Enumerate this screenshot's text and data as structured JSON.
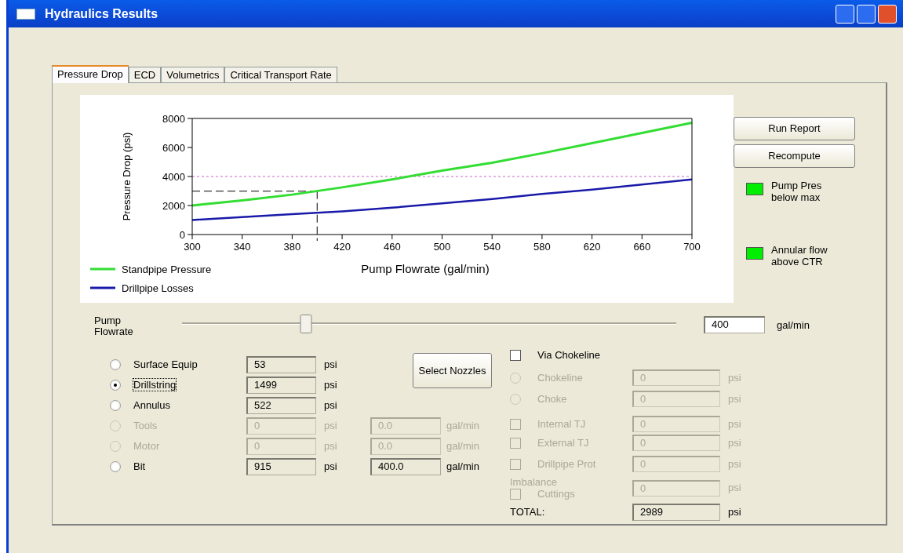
{
  "window": {
    "title": "Hydraulics Results"
  },
  "tabs": [
    {
      "label": "Pressure Drop",
      "selected": true
    },
    {
      "label": "ECD",
      "selected": false
    },
    {
      "label": "Volumetrics",
      "selected": false
    },
    {
      "label": "Critical Transport Rate",
      "selected": false
    }
  ],
  "chart": {
    "chart_data": {
      "type": "line",
      "xlabel": "Pump Flowrate (gal/min)",
      "ylabel": "Pressure Drop (psi)",
      "x": [
        300,
        340,
        380,
        420,
        460,
        500,
        540,
        580,
        620,
        660,
        700
      ],
      "series": [
        {
          "name": "Standpipe Pressure",
          "color": "#33dd33",
          "values": [
            2000,
            2350,
            2750,
            3250,
            3800,
            4400,
            4950,
            5600,
            6300,
            7000,
            7700
          ]
        },
        {
          "name": "Drillpipe Losses",
          "color": "#1a1aaa",
          "values": [
            1000,
            1200,
            1400,
            1600,
            1850,
            2150,
            2450,
            2800,
            3100,
            3450,
            3800
          ]
        }
      ],
      "xlim": [
        300,
        700
      ],
      "ylim": [
        0,
        8000
      ],
      "xticks": [
        300,
        340,
        380,
        420,
        460,
        500,
        540,
        580,
        620,
        660,
        700
      ],
      "yticks": [
        0,
        2000,
        4000,
        6000,
        8000
      ],
      "legend": true,
      "ref_lines": [
        {
          "axis": "y",
          "value": 4000,
          "color": "#cc66cc"
        },
        {
          "axis": "y",
          "value": 2989,
          "color": "#000000"
        },
        {
          "axis": "x",
          "value": 400,
          "color": "#000000"
        }
      ]
    }
  },
  "buttons": [
    {
      "label": "Run Report"
    },
    {
      "label": "Recompute"
    }
  ],
  "indicators": [
    {
      "label": "Pump Pres below max",
      "color": "#00ee00"
    },
    {
      "label": "Annular flow above CTR",
      "color": "#00ee00"
    }
  ],
  "flowrate": {
    "label": "Pump Flowrate",
    "level": 0.25,
    "value": "400",
    "unit": "gal/min"
  },
  "components": [
    {
      "label": "Surface Equip",
      "selected": false,
      "focused": false,
      "disabled": false,
      "pressure": "53",
      "unit": "psi"
    },
    {
      "label": "Drillstring",
      "selected": true,
      "focused": true,
      "disabled": false,
      "pressure": "1499",
      "unit": "psi"
    },
    {
      "label": "Annulus",
      "selected": false,
      "focused": false,
      "disabled": false,
      "pressure": "522",
      "unit": "psi"
    },
    {
      "label": "Tools",
      "selected": false,
      "focused": false,
      "disabled": true,
      "pressure": "0",
      "unit": "psi",
      "flow": "0.0",
      "flow_unit": "gal/min"
    },
    {
      "label": "Motor",
      "selected": false,
      "focused": false,
      "disabled": true,
      "pressure": "0",
      "unit": "psi",
      "flow": "0.0",
      "flow_unit": "gal/min"
    },
    {
      "label": "Bit",
      "selected": false,
      "focused": false,
      "disabled": false,
      "pressure": "915",
      "unit": "psi",
      "flow": "400.0",
      "flow_unit": "gal/min"
    }
  ],
  "select_nozzles": {
    "label": "Select Nozzles"
  },
  "chokeline": {
    "label": "Via Chokeline",
    "checked": false
  },
  "extras": [
    {
      "kind": "radio",
      "label": "Chokeline",
      "selected": false,
      "disabled": true,
      "value": "0",
      "unit": "psi"
    },
    {
      "kind": "radio",
      "label": "Choke",
      "selected": false,
      "disabled": true,
      "value": "0",
      "unit": "psi"
    },
    {
      "kind": "checkbox",
      "label": "Internal TJ",
      "checked": false,
      "disabled": true,
      "value": "0",
      "unit": "psi"
    },
    {
      "kind": "checkbox",
      "label": "External TJ",
      "checked": false,
      "disabled": true,
      "value": "0",
      "unit": "psi"
    },
    {
      "kind": "checkbox",
      "label": "Drillpipe Prot",
      "checked": false,
      "disabled": true,
      "value": "0",
      "unit": "psi"
    },
    {
      "kind": "checkbox",
      "group_label": "Imbalance",
      "label": "Cuttings",
      "checked": false,
      "disabled": true,
      "value": "0",
      "unit": "psi"
    }
  ],
  "total": {
    "label": "TOTAL:",
    "value": "2989",
    "unit": "psi"
  }
}
